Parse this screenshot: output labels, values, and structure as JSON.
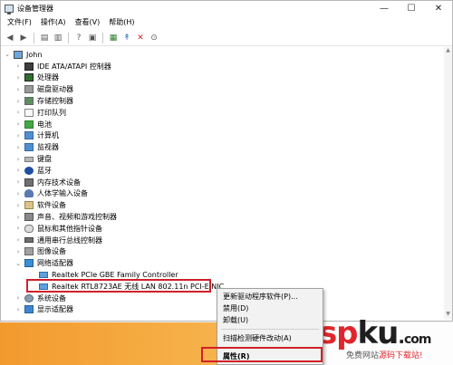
{
  "window": {
    "title": "设备管理器",
    "min": "—",
    "max": "☐",
    "close": "✕"
  },
  "menu": [
    "文件(F)",
    "操作(A)",
    "查看(V)",
    "帮助(H)"
  ],
  "toolbar": [
    "back",
    "forward",
    "properties",
    "show-hidden",
    "help",
    "scan",
    "update",
    "uninstall",
    "download"
  ],
  "tree": {
    "root": "John",
    "categories": [
      "IDE ATA/ATAPI 控制器",
      "处理器",
      "磁盘驱动器",
      "存储控制器",
      "打印队列",
      "电池",
      "计算机",
      "监视器",
      "键盘",
      "蓝牙",
      "内存技术设备",
      "人体学输入设备",
      "软件设备",
      "声音、视频和游戏控制器",
      "鼠标和其他指针设备",
      "通用串行总线控制器",
      "图像设备",
      "网络适配器"
    ],
    "network_devices": [
      "Realtek PCIe GBE Family Controller",
      "Realtek RTL8723AE 无线 LAN 802.11n PCI-E NIC"
    ],
    "after": [
      "系统设备",
      "显示适配器"
    ]
  },
  "context_menu": {
    "items": [
      "更新驱动程序软件(P)...",
      "禁用(D)",
      "卸载(U)",
      "扫描检测硬件改动(A)",
      "属性(R)"
    ]
  },
  "watermark": {
    "a": "asp",
    "k": "ku",
    "dot": ".",
    "tld": "com",
    "sub_pre": "免费网站",
    "sub": "源码下载站!"
  }
}
